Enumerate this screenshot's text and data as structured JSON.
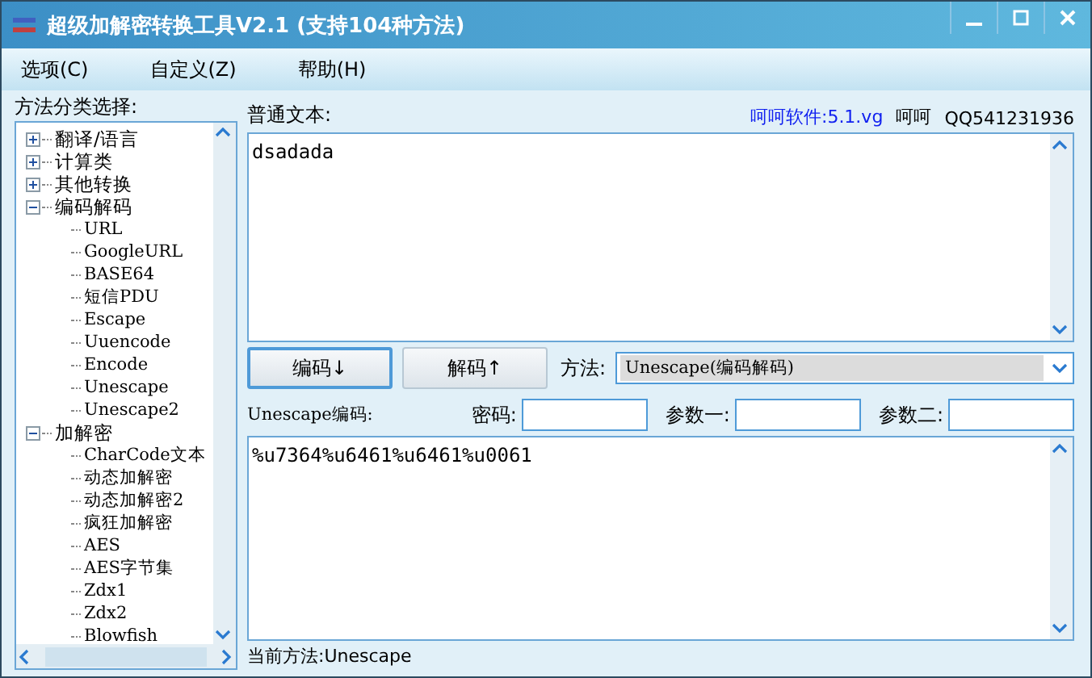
{
  "window": {
    "title": "超级加解密转换工具V2.1 (支持104种方法)"
  },
  "menu": [
    {
      "label": "选项(C)"
    },
    {
      "label": "自定义(Z)"
    },
    {
      "label": "帮助(H)"
    }
  ],
  "sidebar": {
    "label": "方法分类选择:",
    "tree": [
      {
        "label": "翻译/语言",
        "expanded": false
      },
      {
        "label": "计算类",
        "expanded": false
      },
      {
        "label": "其他转换",
        "expanded": false
      },
      {
        "label": "编码解码",
        "expanded": true,
        "children": [
          {
            "label": "URL"
          },
          {
            "label": "GoogleURL"
          },
          {
            "label": "BASE64"
          },
          {
            "label": "短信PDU"
          },
          {
            "label": "Escape"
          },
          {
            "label": "Uuencode"
          },
          {
            "label": "Encode"
          },
          {
            "label": "Unescape"
          },
          {
            "label": "Unescape2"
          }
        ]
      },
      {
        "label": "加解密",
        "expanded": true,
        "children": [
          {
            "label": "CharCode文本"
          },
          {
            "label": "动态加解密"
          },
          {
            "label": "动态加解密2"
          },
          {
            "label": "疯狂加解密"
          },
          {
            "label": "AES"
          },
          {
            "label": "AES字节集"
          },
          {
            "label": "Zdx1"
          },
          {
            "label": "Zdx2"
          },
          {
            "label": "Blowfish"
          }
        ]
      }
    ]
  },
  "input": {
    "label": "普通文本:",
    "value": "dsadada"
  },
  "credits": {
    "link": "呵呵软件:5.1.vg",
    "author": "呵呵",
    "contact": "QQ541231936"
  },
  "buttons": [
    {
      "label": "编码↓",
      "focused": true
    },
    {
      "label": "解码↑",
      "focused": false
    }
  ],
  "method": {
    "label": "方法:",
    "value": "Unescape(编码解码)"
  },
  "output": {
    "label": "Unescape编码:",
    "value": "%u7364%u6461%u6461%u0061"
  },
  "params": [
    {
      "label": "密码:"
    },
    {
      "label": "参数一:"
    },
    {
      "label": "参数二:"
    }
  ],
  "status": "当前方法:Unescape"
}
